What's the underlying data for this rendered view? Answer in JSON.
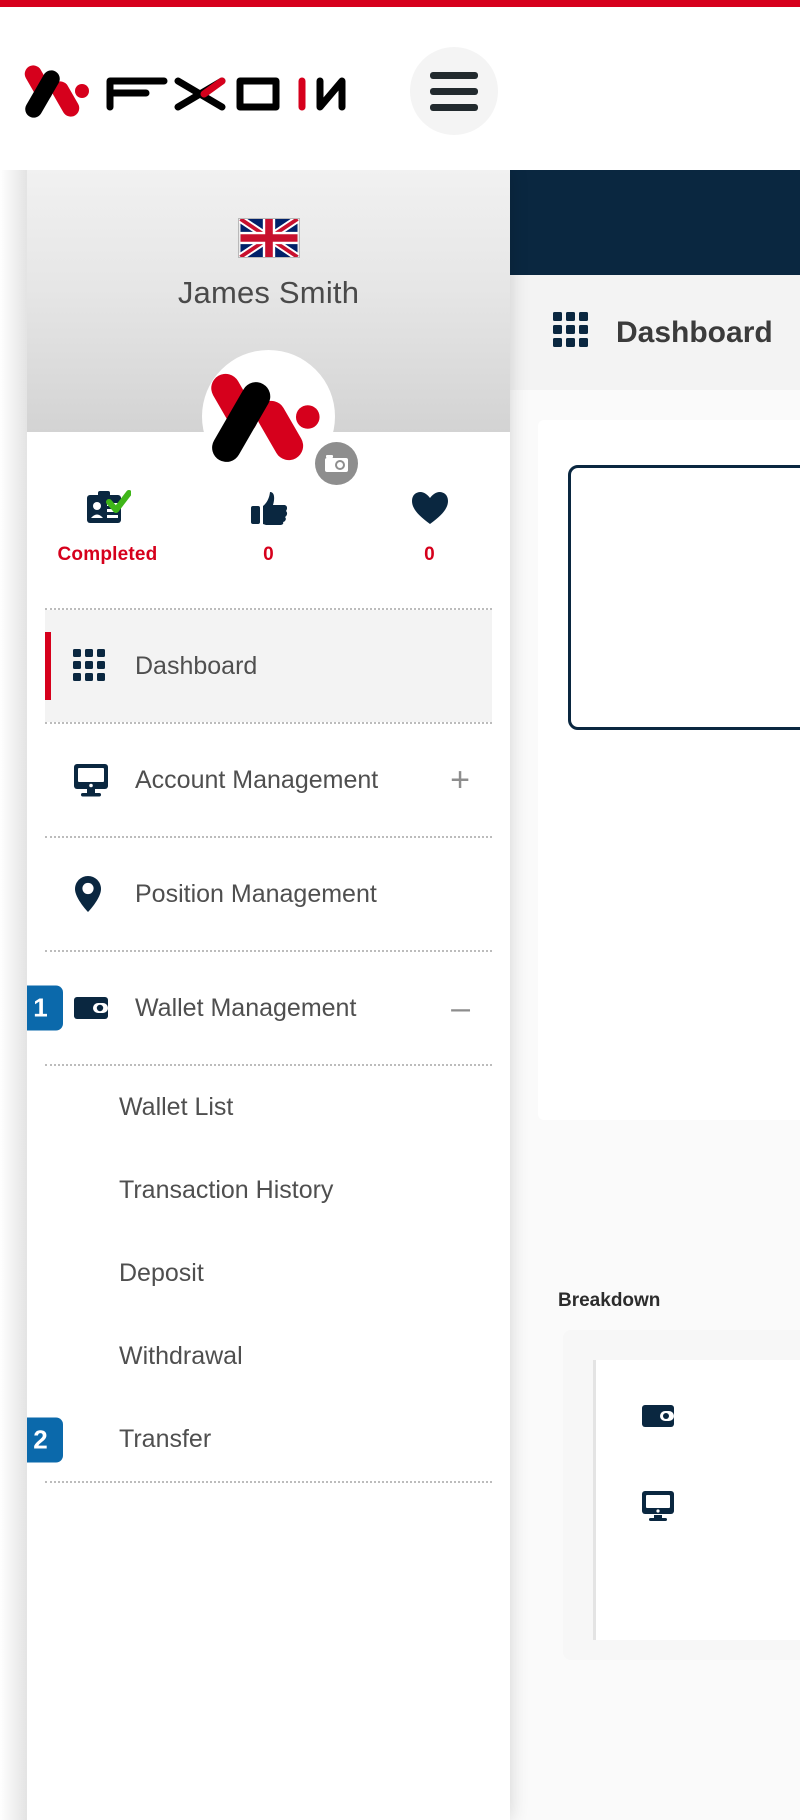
{
  "brand": {
    "name": "FXON",
    "accent_red": "#d6001c",
    "navy": "#0a2740",
    "badge_blue": "#0b69ab"
  },
  "header": {
    "logo_text": "FXON",
    "menu_button_label": "Menu"
  },
  "main": {
    "page_title": "Dashboard",
    "breakdown_title": "Breakdown"
  },
  "drawer": {
    "language_flag": "uk-flag-icon",
    "user_name": "James Smith",
    "avatar_icon": "fxon-logo-icon",
    "camera_button_label": "camera-icon",
    "stats": [
      {
        "icon": "id-card-check-icon",
        "value": "Completed"
      },
      {
        "icon": "thumbs-up-icon",
        "value": "0"
      },
      {
        "icon": "heart-icon",
        "value": "0"
      }
    ],
    "menu": [
      {
        "label": "Dashboard",
        "icon": "grid-icon",
        "active": true,
        "expander": "",
        "badge": ""
      },
      {
        "label": "Account Management",
        "icon": "monitor-icon",
        "active": false,
        "expander": "+",
        "badge": ""
      },
      {
        "label": "Position Management",
        "icon": "map-pin-icon",
        "active": false,
        "expander": "",
        "badge": ""
      },
      {
        "label": "Wallet Management",
        "icon": "wallet-icon",
        "active": false,
        "expander": "–",
        "badge": "1"
      }
    ],
    "submenu": [
      {
        "label": "Wallet List",
        "badge": ""
      },
      {
        "label": "Transaction History",
        "badge": ""
      },
      {
        "label": "Deposit",
        "badge": ""
      },
      {
        "label": "Withdrawal",
        "badge": ""
      },
      {
        "label": "Transfer",
        "badge": "2"
      }
    ]
  }
}
